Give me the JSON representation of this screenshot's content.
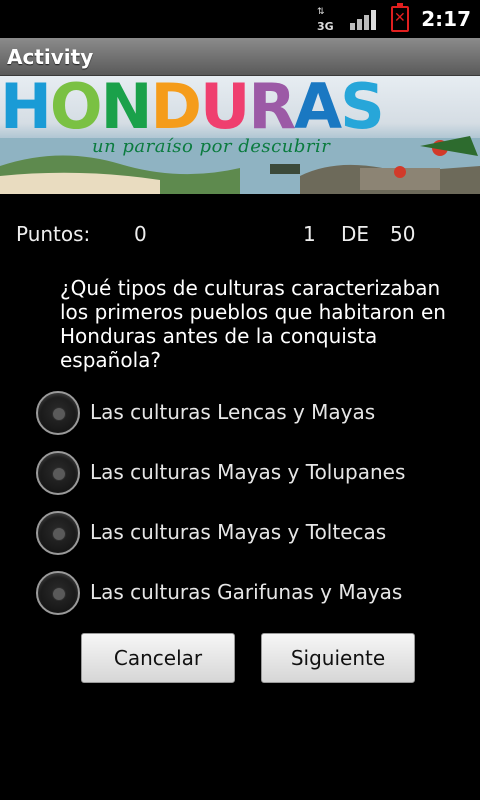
{
  "status_bar": {
    "network_label": "3G",
    "network_icon": "3g-data-icon",
    "signal_icon": "signal-strength-icon",
    "battery_icon": "battery-empty-icon",
    "battery_color": "#e01f1f",
    "time": "2:17"
  },
  "title_bar": {
    "title": "Activity"
  },
  "banner": {
    "letters": [
      {
        "ch": "H",
        "color": "#1a9bd6"
      },
      {
        "ch": "O",
        "color": "#7ac143"
      },
      {
        "ch": "N",
        "color": "#1aa14a"
      },
      {
        "ch": "D",
        "color": "#f59c1a"
      },
      {
        "ch": "U",
        "color": "#ef3f6f"
      },
      {
        "ch": "R",
        "color": "#9c5aa6"
      },
      {
        "ch": "A",
        "color": "#1a78c2"
      },
      {
        "ch": "S",
        "color": "#27a6d9"
      }
    ],
    "slogan": "un paraíso por descubrir"
  },
  "score": {
    "points_label": "Puntos:",
    "points_value": "0",
    "current": "1",
    "of_label": "DE",
    "total": "50"
  },
  "question": "¿Qué tipos de culturas caracterizaban los primeros pueblos que habitaron en Honduras antes de la conquista española?",
  "options": [
    {
      "label": "Las culturas Lencas y Mayas"
    },
    {
      "label": "Las culturas Mayas y Tolupanes"
    },
    {
      "label": "Las culturas Mayas y Toltecas"
    },
    {
      "label": "Las culturas Garifunas y Mayas"
    }
  ],
  "buttons": {
    "cancel": "Cancelar",
    "next": "Siguiente"
  }
}
